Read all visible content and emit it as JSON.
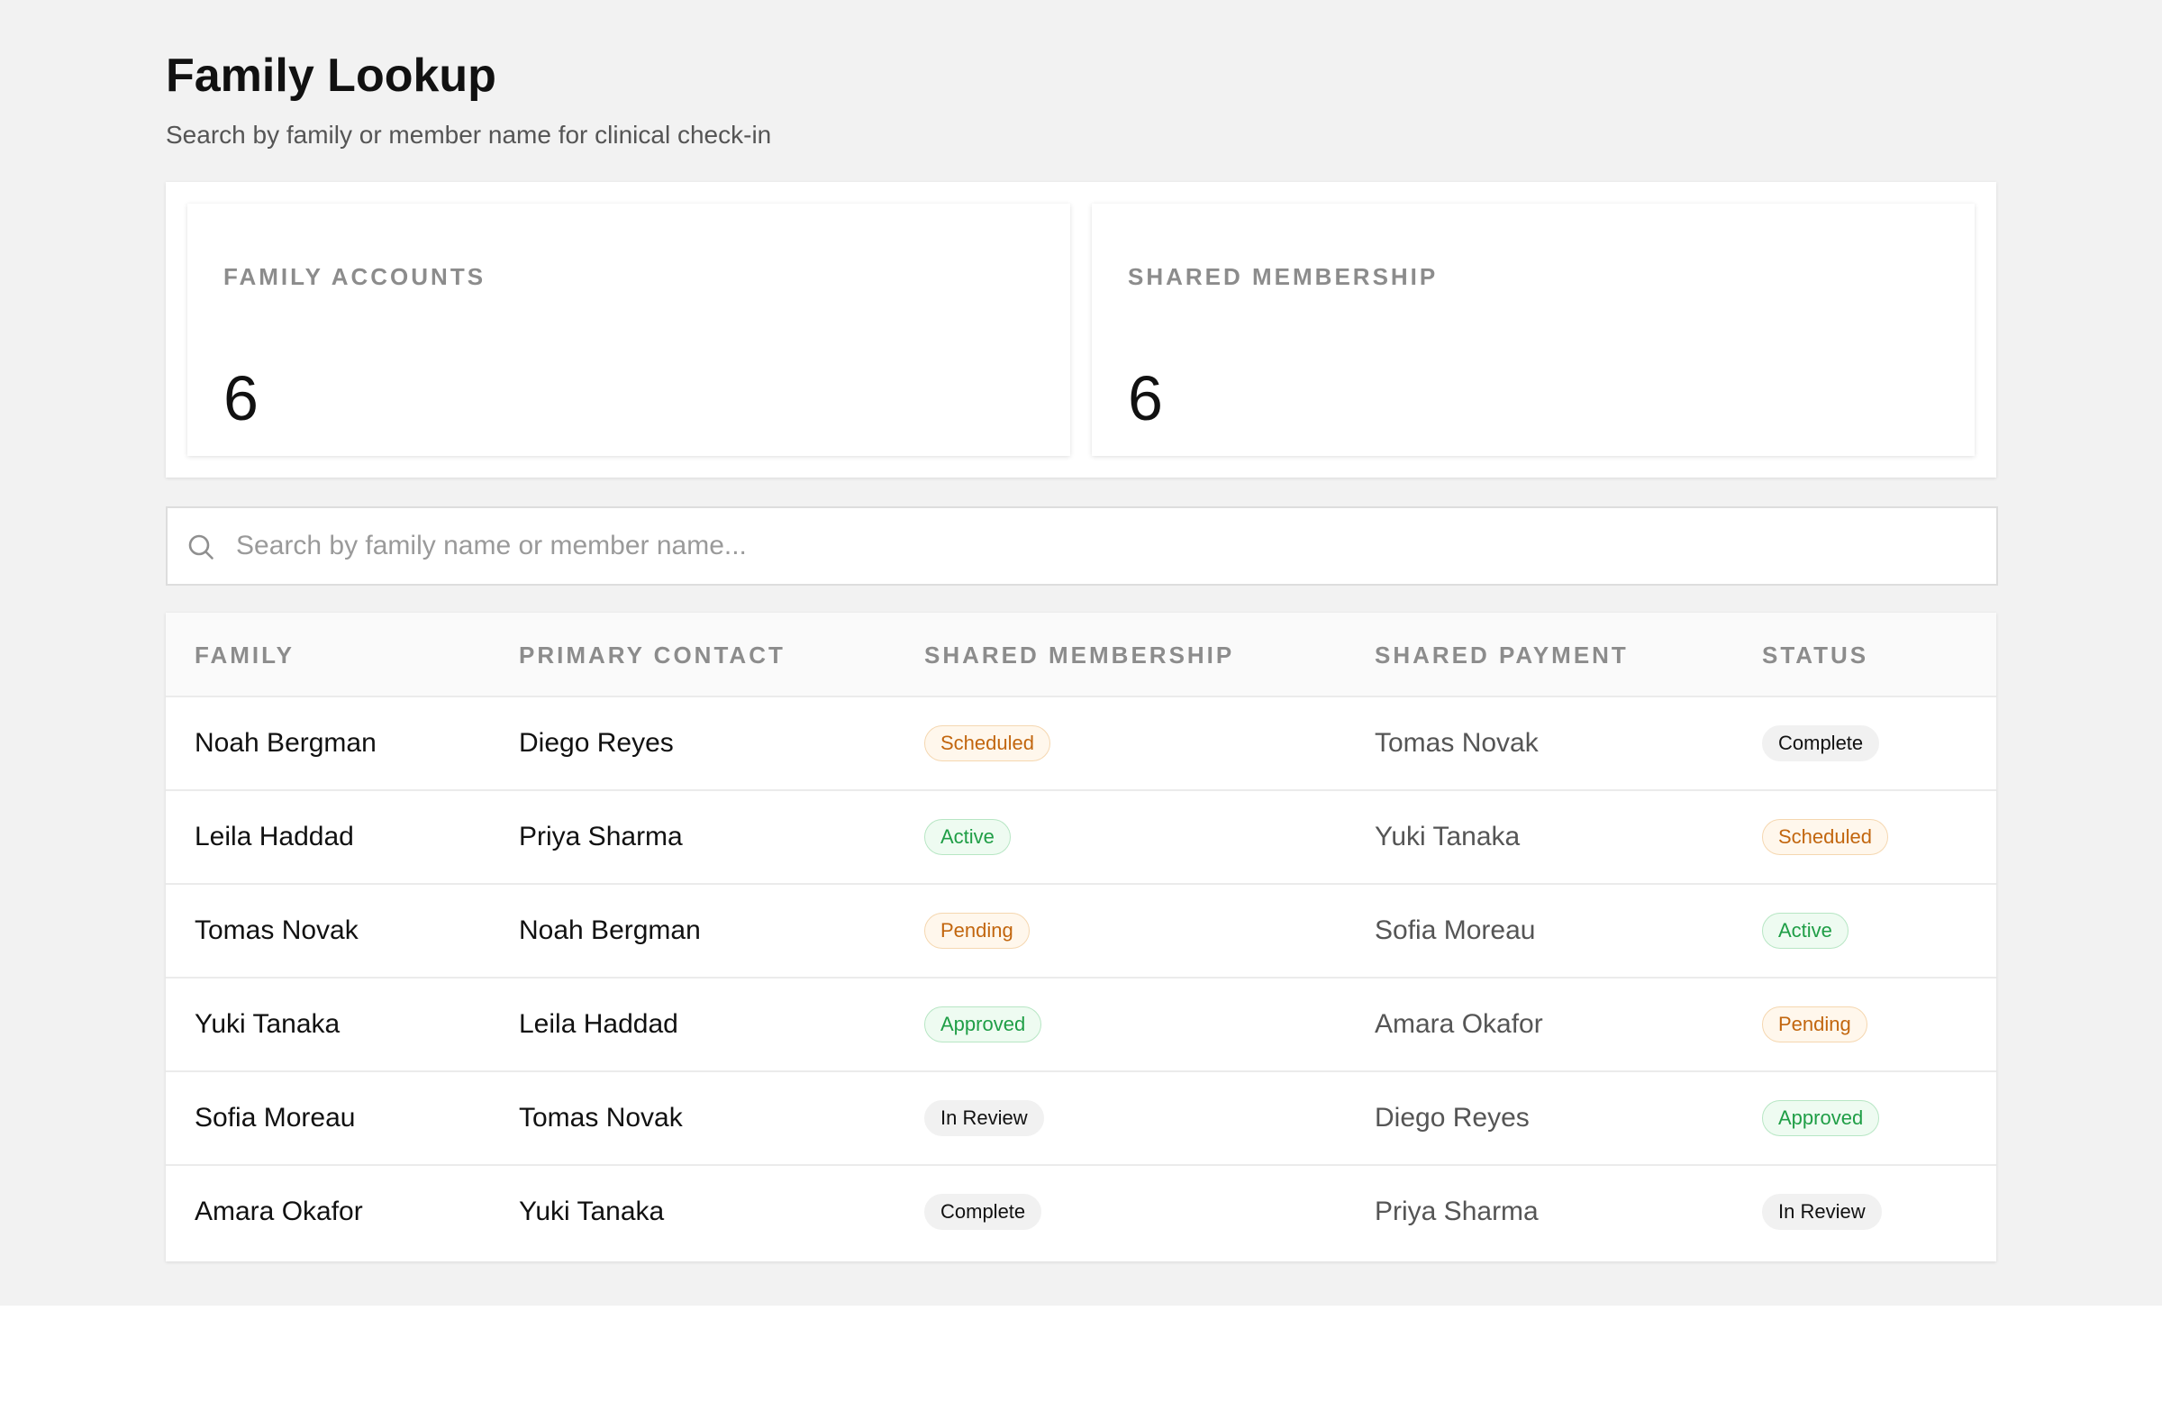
{
  "page": {
    "title": "Family Lookup",
    "subtitle": "Search by family or member name for clinical check-in"
  },
  "stats": [
    {
      "label": "FAMILY ACCOUNTS",
      "value": "6"
    },
    {
      "label": "SHARED MEMBERSHIP",
      "value": "6"
    }
  ],
  "search": {
    "placeholder": "Search by family name or member name...",
    "value": ""
  },
  "table": {
    "columns": [
      "FAMILY",
      "PRIMARY CONTACT",
      "SHARED MEMBERSHIP",
      "SHARED PAYMENT",
      "STATUS"
    ],
    "rows": [
      {
        "family": "Noah Bergman",
        "contact": "Diego Reyes",
        "membership": "Scheduled",
        "payment": "Tomas Novak",
        "status": "Complete"
      },
      {
        "family": "Leila Haddad",
        "contact": "Priya Sharma",
        "membership": "Active",
        "payment": "Yuki Tanaka",
        "status": "Scheduled"
      },
      {
        "family": "Tomas Novak",
        "contact": "Noah Bergman",
        "membership": "Pending",
        "payment": "Sofia Moreau",
        "status": "Active"
      },
      {
        "family": "Yuki Tanaka",
        "contact": "Leila Haddad",
        "membership": "Approved",
        "payment": "Amara Okafor",
        "status": "Pending"
      },
      {
        "family": "Sofia Moreau",
        "contact": "Tomas Novak",
        "membership": "In Review",
        "payment": "Diego Reyes",
        "status": "Approved"
      },
      {
        "family": "Amara Okafor",
        "contact": "Yuki Tanaka",
        "membership": "Complete",
        "payment": "Priya Sharma",
        "status": "In Review"
      }
    ]
  },
  "badge_colors": {
    "Scheduled": "#c2660e",
    "Pending": "#c2660e",
    "Active": "#1f9e46",
    "Approved": "#1f9e46",
    "In Review": "#111111",
    "Complete": "#111111"
  }
}
